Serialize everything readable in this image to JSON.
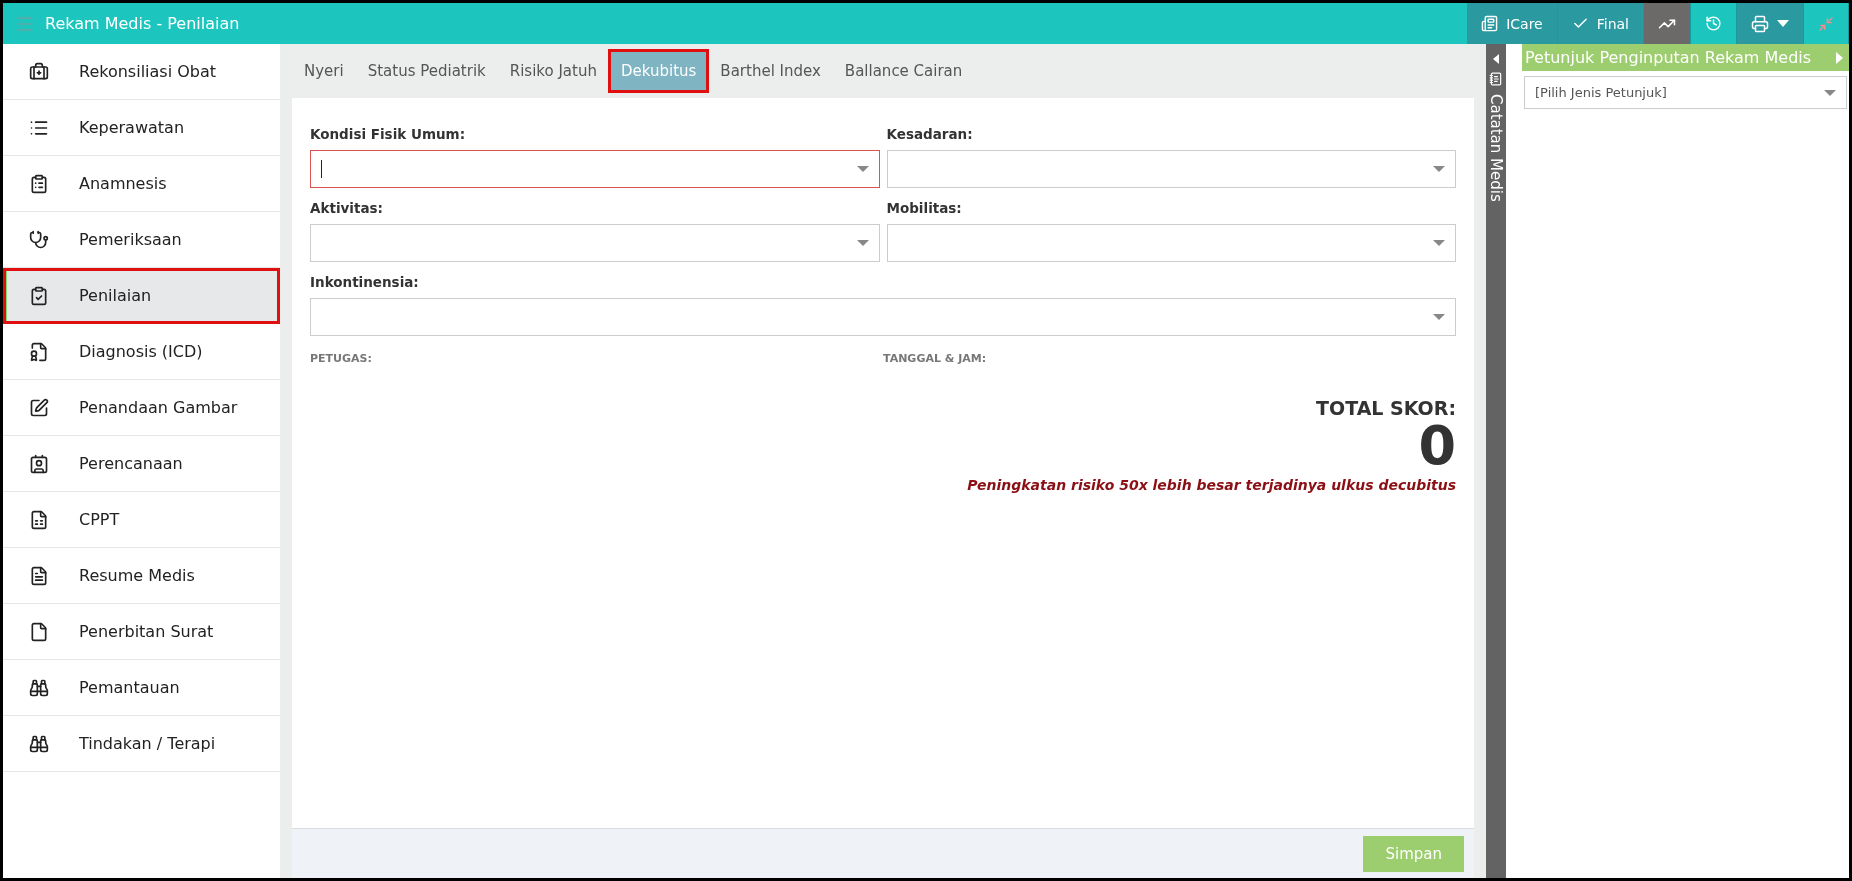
{
  "window": {
    "title": "Rekam Medis - Penilaian"
  },
  "toolbar": [
    {
      "kind": "text",
      "label": "ICare",
      "selected": false
    },
    {
      "kind": "text",
      "label": "Final",
      "selected": false
    },
    {
      "kind": "chart",
      "selected": true
    },
    {
      "kind": "history",
      "selected": false
    },
    {
      "kind": "print",
      "selected": false
    },
    {
      "kind": "shrink",
      "selected": false
    }
  ],
  "sidebar": {
    "items": [
      {
        "label": "Rekonsiliasi Obat",
        "selected": false
      },
      {
        "label": "Keperawatan",
        "selected": false
      },
      {
        "label": "Anamnesis",
        "selected": false
      },
      {
        "label": "Pemeriksaan",
        "selected": false
      },
      {
        "label": "Penilaian",
        "selected": true
      },
      {
        "label": "Diagnosis (ICD)",
        "selected": false
      },
      {
        "label": "Penandaan Gambar",
        "selected": false
      },
      {
        "label": "Perencanaan",
        "selected": false
      },
      {
        "label": "CPPT",
        "selected": false
      },
      {
        "label": "Resume Medis",
        "selected": false
      },
      {
        "label": "Penerbitan Surat",
        "selected": false
      },
      {
        "label": "Pemantauan",
        "selected": false
      },
      {
        "label": "Tindakan / Terapi",
        "selected": false
      }
    ]
  },
  "tabs": [
    {
      "label": "Nyeri",
      "selected": false
    },
    {
      "label": "Status Pediatrik",
      "selected": false
    },
    {
      "label": "Risiko Jatuh",
      "selected": false
    },
    {
      "label": "Dekubitus",
      "selected": true
    },
    {
      "label": "Barthel Index",
      "selected": false
    },
    {
      "label": "Ballance Cairan",
      "selected": false
    }
  ],
  "form": {
    "fields": [
      {
        "label": "Kondisi Fisik Umum:",
        "focused": true,
        "wide": false
      },
      {
        "label": "Kesadaran:",
        "focused": false,
        "wide": false
      },
      {
        "label": "Aktivitas:",
        "focused": false,
        "wide": false
      },
      {
        "label": "Mobilitas:",
        "focused": false,
        "wide": false
      },
      {
        "label": "Inkontinensia:",
        "focused": false,
        "wide": true
      }
    ],
    "petugas_label": "PETUGAS:",
    "tanggal_label": "TANGGAL & JAM:",
    "total_label": "TOTAL SKOR:",
    "total_value": "0",
    "risk_note": "Peningkatan risiko 50x lebih besar terjadinya ulkus decubitus",
    "save_button": "Simpan"
  },
  "side_strip": {
    "label": "Catatan Medis"
  },
  "guide_panel": {
    "title": "Petunjuk Penginputan Rekam Medis",
    "select": "[Pilih Jenis Petunjuk]"
  }
}
